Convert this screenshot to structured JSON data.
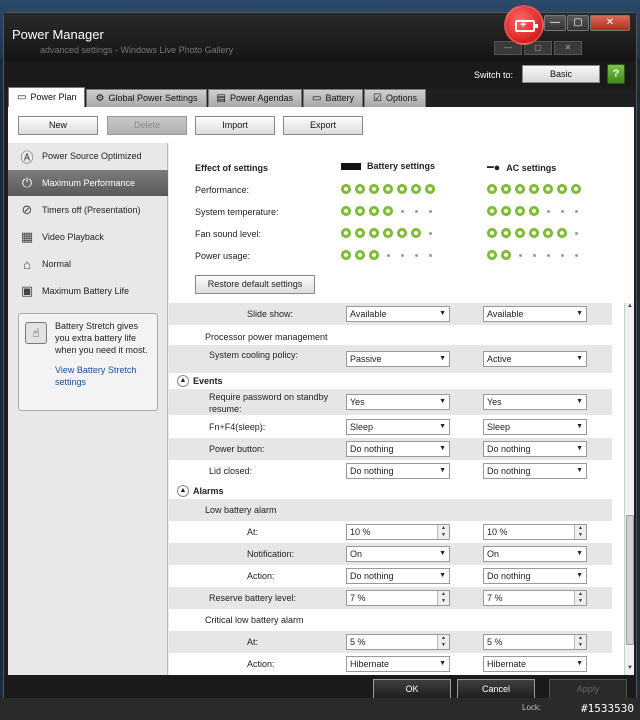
{
  "window": {
    "title": "Power Manager",
    "ghost_title": "advanced settings - Windows Live Photo Gallery"
  },
  "switch": {
    "label": "Switch to:",
    "button": "Basic",
    "help": "?"
  },
  "tabs": [
    {
      "label": "Power Plan",
      "icon": "battery-plug-icon"
    },
    {
      "label": "Global Power Settings",
      "icon": "gear-icon"
    },
    {
      "label": "Power Agendas",
      "icon": "calendar-icon"
    },
    {
      "label": "Battery",
      "icon": "battery-icon"
    },
    {
      "label": "Options",
      "icon": "checkbox-icon"
    }
  ],
  "toolbar": {
    "new": "New",
    "delete": "Delete",
    "import": "Import",
    "export": "Export"
  },
  "plans": [
    {
      "label": "Power Source Optimized",
      "icon": "auto-icon",
      "glyph": "Ⓐ"
    },
    {
      "label": "Maximum Performance",
      "icon": "power-icon",
      "glyph": "⏻"
    },
    {
      "label": "Timers off (Presentation)",
      "icon": "projector-icon",
      "glyph": "⊘"
    },
    {
      "label": "Video Playback",
      "icon": "film-icon",
      "glyph": "▦"
    },
    {
      "label": "Normal",
      "icon": "home-icon",
      "glyph": "⌂"
    },
    {
      "label": "Maximum Battery Life",
      "icon": "battery-clock-icon",
      "glyph": "▣"
    }
  ],
  "stretch": {
    "text": "Battery Stretch gives you extra battery life when you need it most.",
    "link": "View Battery Stretch settings"
  },
  "effects": {
    "title": "Effect of settings",
    "battery_head": "Battery settings",
    "ac_head": "AC settings",
    "rows": [
      {
        "label": "Performance:",
        "battery": 7,
        "ac": 7
      },
      {
        "label": "System temperature:",
        "battery": 4,
        "ac": 4
      },
      {
        "label": "Fan sound level:",
        "battery": 6,
        "ac": 6
      },
      {
        "label": "Power usage:",
        "battery": 3,
        "ac": 2
      }
    ],
    "restore": "Restore default settings"
  },
  "settings": {
    "slideshow": {
      "label": "Slide show:",
      "battery": "Available",
      "ac": "Available"
    },
    "processor": {
      "label": "Processor power management"
    },
    "cooling": {
      "label": "System cooling policy:",
      "battery": "Passive",
      "ac": "Active"
    },
    "events_head": "Events",
    "password": {
      "label": "Require password on standby resume:",
      "battery": "Yes",
      "ac": "Yes"
    },
    "fnf4": {
      "label": "Fn+F4(sleep):",
      "battery": "Sleep",
      "ac": "Sleep"
    },
    "powerbtn": {
      "label": "Power button:",
      "battery": "Do nothing",
      "ac": "Do nothing"
    },
    "lid": {
      "label": "Lid closed:",
      "battery": "Do nothing",
      "ac": "Do nothing"
    },
    "alarms_head": "Alarms",
    "low_alarm": {
      "label": "Low battery alarm"
    },
    "low_at": {
      "label": "At:",
      "battery": "10 %",
      "ac": "10 %"
    },
    "low_notif": {
      "label": "Notification:",
      "battery": "On",
      "ac": "On"
    },
    "low_action": {
      "label": "Action:",
      "battery": "Do nothing",
      "ac": "Do nothing"
    },
    "reserve": {
      "label": "Reserve battery level:",
      "battery": "7 %",
      "ac": "7 %"
    },
    "crit_alarm": {
      "label": "Critical low battery alarm"
    },
    "crit_at": {
      "label": "At:",
      "battery": "5 %",
      "ac": "5 %"
    },
    "crit_action": {
      "label": "Action:",
      "battery": "Hibernate",
      "ac": "Hibernate"
    }
  },
  "footer": {
    "ok": "OK",
    "cancel": "Cancel",
    "apply": "Apply"
  },
  "watermark": "#1533530",
  "taskbar_lock": "Lock:"
}
